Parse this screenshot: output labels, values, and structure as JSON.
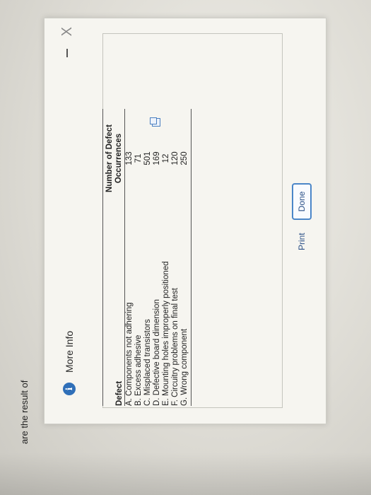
{
  "backdrop": {
    "text": "are the result of"
  },
  "dialog": {
    "title": "More Info",
    "info_icon": "info-icon",
    "window_controls": [
      "minimize-icon",
      "close-icon"
    ],
    "close_glyph": "X"
  },
  "table": {
    "headers": {
      "defect": "Defect",
      "occurrences_line1": "Number of Defect",
      "occurrences_line2": "Occurrences"
    },
    "rows": [
      {
        "defect": "A. Components not adhering",
        "count": "133"
      },
      {
        "defect": "B. Excess adhesive",
        "count": "71"
      },
      {
        "defect": "C. Misplaced transistors",
        "count": "501"
      },
      {
        "defect": "D. Defective board dimension",
        "count": "169"
      },
      {
        "defect": "E. Mounting holes improperly positioned",
        "count": "12"
      },
      {
        "defect": "F. Circuitry problems on final test",
        "count": "120"
      },
      {
        "defect": "G. Wrong component",
        "count": "250"
      }
    ]
  },
  "buttons": {
    "print": "Print",
    "done": "Done"
  }
}
